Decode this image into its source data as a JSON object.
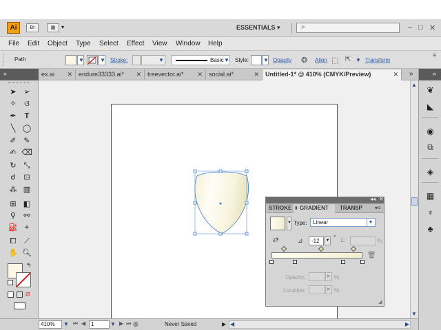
{
  "app": {
    "logo": "Ai",
    "workspace": "ESSENTIALS",
    "bridge_label": "Br",
    "window_controls": [
      "–",
      "□",
      "✕"
    ],
    "accent": "#f4a20c"
  },
  "menu": [
    "File",
    "Edit",
    "Object",
    "Type",
    "Select",
    "Effect",
    "View",
    "Window",
    "Help"
  ],
  "control": {
    "path_label": "Path",
    "stroke_label": "Stroke:",
    "brush_label": "Basic",
    "style_label": "Style:",
    "opacity_label": "Opacity",
    "align_label": "Align",
    "transform_label": "Transform"
  },
  "tabs": [
    {
      "label": "ex.ai",
      "close": "✕"
    },
    {
      "label": "endure33333.ai*",
      "close": "✕"
    },
    {
      "label": "treevector.ai*",
      "close": "✕"
    },
    {
      "label": "social.ai*",
      "close": "✕"
    },
    {
      "label": "Untitled-1* @ 410% (CMYK/Preview)",
      "close": "✕"
    }
  ],
  "tabs_overflow": "»",
  "gradient_panel": {
    "tabs": [
      "STROKE",
      "GRADIENT",
      "TRANSP"
    ],
    "type_label": "Type:",
    "type_value": "Linear",
    "angle_value": "-12",
    "angle_unit": "°",
    "percent": "%",
    "opacity_label": "Opacity:",
    "location_label": "Location:",
    "gradient_colors": [
      "#fefdf2",
      "#f2edd0"
    ]
  },
  "status": {
    "zoom": "410%",
    "page": "1",
    "save_state": "Never Saved"
  }
}
